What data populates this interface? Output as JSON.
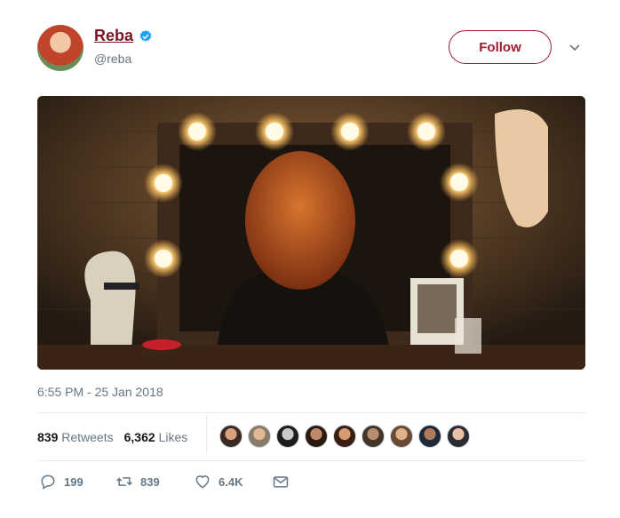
{
  "user": {
    "name": "Reba",
    "handle": "@reba",
    "verified": true,
    "brand_color": "#9b1c2e"
  },
  "header": {
    "follow_label": "Follow",
    "more_icon": "chevron-down-icon"
  },
  "tweet": {
    "timestamp": "6:55 PM - 25 Jan 2018",
    "retweets_count": "839",
    "retweets_label": "Retweets",
    "likes_count": "6,362",
    "likes_label": "Likes",
    "liker_avatars": 9
  },
  "actions": {
    "reply_count": "199",
    "retweet_count": "839",
    "like_count": "6.4K",
    "reply_icon": "reply-icon",
    "retweet_icon": "retweet-icon",
    "like_icon": "heart-icon",
    "dm_icon": "envelope-icon"
  }
}
